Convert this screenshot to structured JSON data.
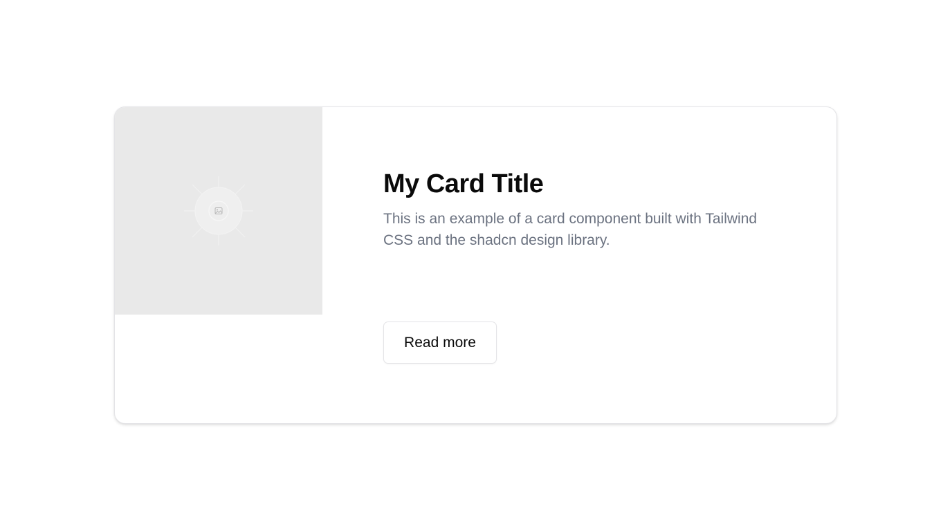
{
  "card": {
    "title": "My Card Title",
    "description": "This is an example of a card component built with Tailwind CSS and the shadcn design library.",
    "button_label": "Read more",
    "image": {
      "icon": "image-placeholder-icon",
      "background_color": "#e9e9e9"
    }
  },
  "colors": {
    "title": "#0a0a0a",
    "description": "#6b7280",
    "border": "#e4e4e7",
    "page_background": "#ffffff"
  }
}
